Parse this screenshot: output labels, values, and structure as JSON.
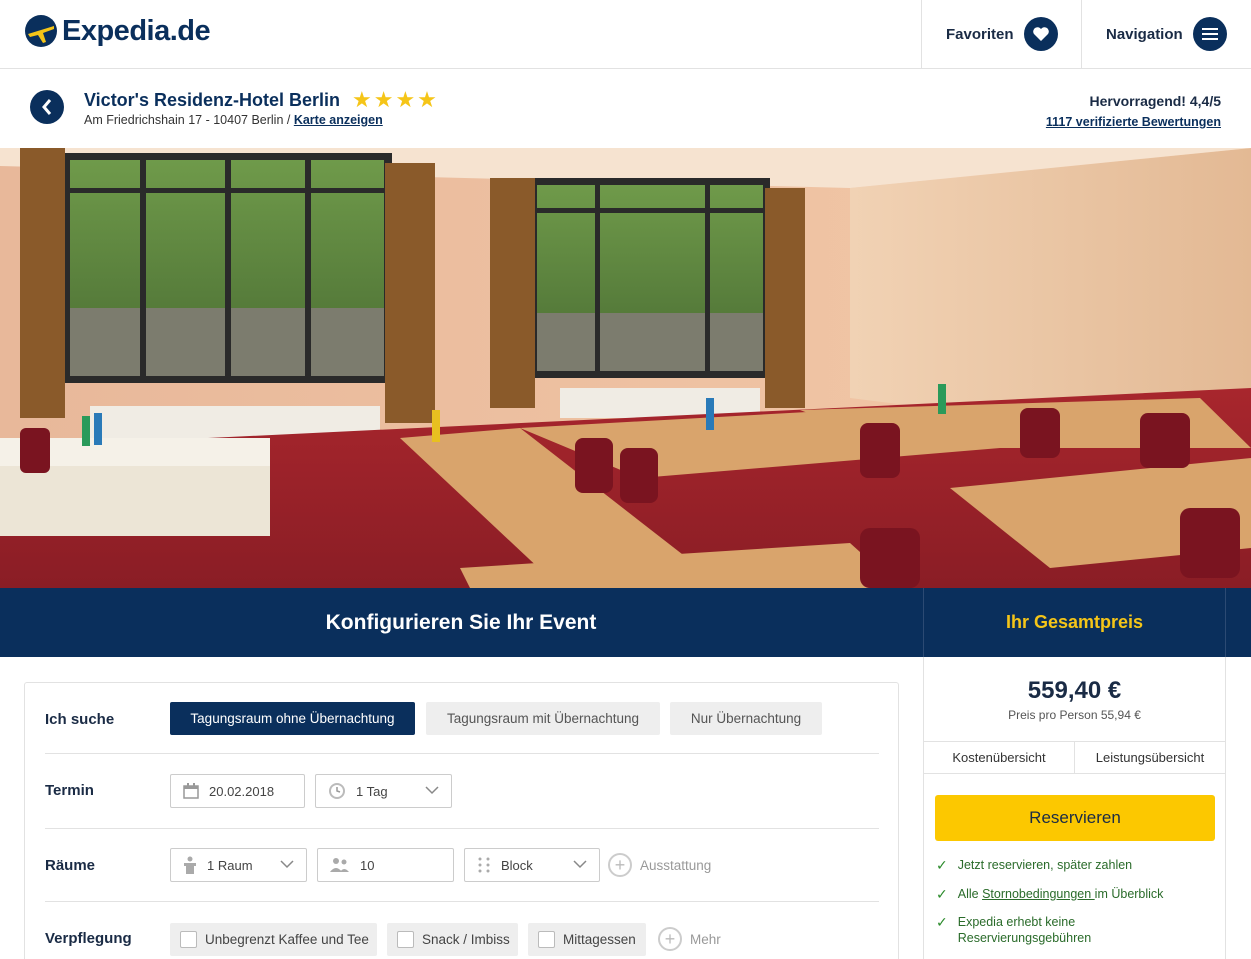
{
  "header": {
    "logo_text": "Expedia.de",
    "favorites_label": "Favoriten",
    "navigation_label": "Navigation"
  },
  "hotel": {
    "name": "Victor's Residenz-Hotel Berlin",
    "stars": "★★★★",
    "address": "Am Friedrichshain 17 - 10407 Berlin / ",
    "map_link": "Karte anzeigen",
    "rating_text": "Hervorragend! 4,4/5",
    "reviews_link": "1117 verifizierte Bewertungen"
  },
  "band": {
    "title": "Konfigurieren Sie Ihr Event",
    "price_title": "Ihr Gesamtpreis"
  },
  "config": {
    "search": {
      "label": "Ich suche",
      "options": [
        "Tagungsraum ohne Übernachtung",
        "Tagungsraum mit Übernachtung",
        "Nur Übernachtung"
      ],
      "selected": "Tagungsraum ohne Übernachtung"
    },
    "date": {
      "label": "Termin",
      "date_value": "20.02.2018",
      "duration_value": "1 Tag"
    },
    "rooms": {
      "label": "Räume",
      "rooms_value": "1 Raum",
      "persons_value": "10",
      "layout_value": "Block",
      "equipment_label": "Ausstattung"
    },
    "catering": {
      "label": "Verpflegung",
      "options": [
        "Unbegrenzt Kaffee und Tee",
        "Snack / Imbiss",
        "Mittagessen"
      ],
      "more_label": "Mehr"
    }
  },
  "pricing": {
    "total": "559,40 €",
    "per_person": "Preis pro Person 55,94 €",
    "tab_costs": "Kostenübersicht",
    "tab_services": "Leistungsübersicht",
    "reserve_label": "Reservieren",
    "perk1": "Jetzt reservieren, später zahlen",
    "perk2_prefix": "Alle ",
    "perk2_link": "Stornobedingungen ",
    "perk2_suffix": "im Überblick",
    "perk3": "Expedia erhebt keine Reservierungsgebühren"
  },
  "colors": {
    "brand_navy": "#0a2f5c",
    "accent_yellow": "#fcc800",
    "star_yellow": "#f5c518",
    "perk_green": "#2a6b2a"
  }
}
